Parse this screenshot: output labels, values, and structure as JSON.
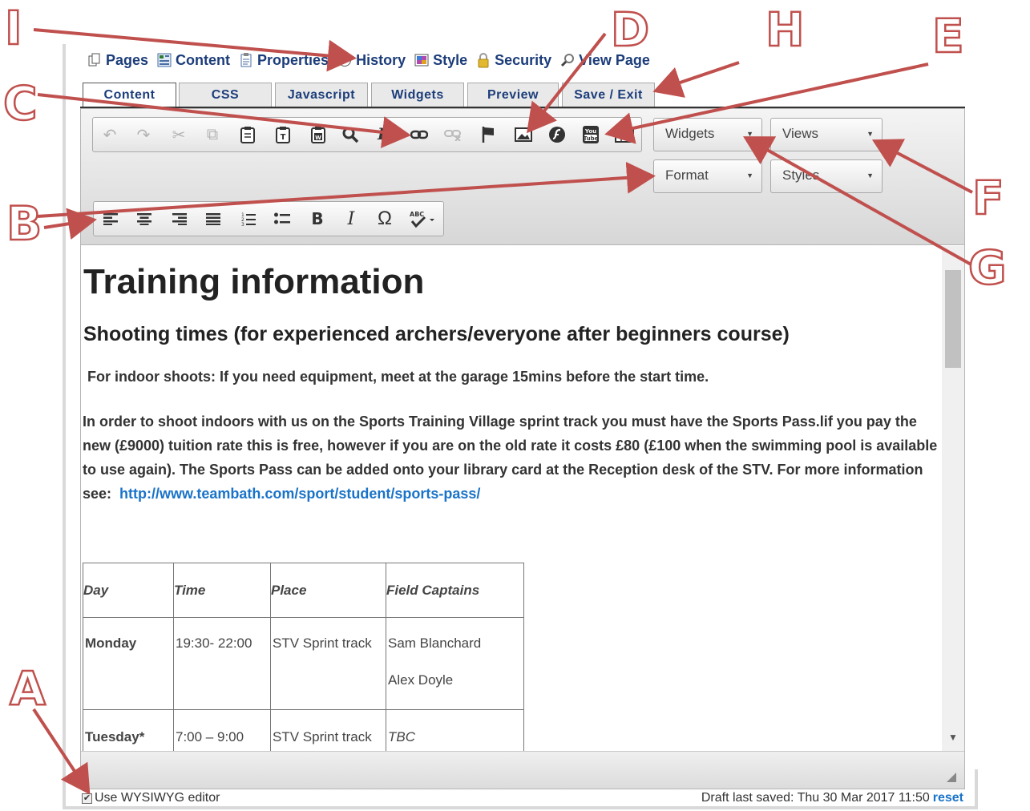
{
  "nav": [
    {
      "label": "Pages",
      "icon": "pages-icon"
    },
    {
      "label": "Content",
      "icon": "content-icon"
    },
    {
      "label": "Properties",
      "icon": "properties-icon"
    },
    {
      "label": "History",
      "icon": "history-icon"
    },
    {
      "label": "Style",
      "icon": "style-icon"
    },
    {
      "label": "Security",
      "icon": "lock-icon"
    },
    {
      "label": "View Page",
      "icon": "magnifier-icon"
    }
  ],
  "tabs": [
    {
      "label": "Content",
      "active": true
    },
    {
      "label": "CSS"
    },
    {
      "label": "Javascript"
    },
    {
      "label": "Widgets"
    },
    {
      "label": "Preview"
    },
    {
      "label": "Save / Exit"
    }
  ],
  "toolbar": {
    "row1": [
      "undo",
      "redo",
      "cut",
      "copy",
      "paste",
      "paste-as-text",
      "paste-from-word",
      "find",
      "remove-format",
      "link",
      "unlink",
      "anchor",
      "image",
      "flash",
      "youtube",
      "table"
    ],
    "row2": [
      "align-left",
      "align-center",
      "align-right",
      "justify",
      "numbered-list",
      "bulleted-list",
      "bold",
      "italic",
      "special-character",
      "spell-check"
    ],
    "combos": {
      "widgets": "Widgets",
      "views": "Views",
      "format": "Format",
      "styles": "Styles"
    }
  },
  "document": {
    "h1": "Training information",
    "h2": "Shooting times (for experienced archers/everyone after beginners course)",
    "p1": "For indoor shoots: If you need equipment, meet at the garage 15mins before the start time.",
    "p2": "In order to shoot indoors with us on the Sports Training Village sprint track you must have the Sports Pass.lif you pay the new (£9000) tuition rate this is free, however if you are on the old rate it costs £80 (£100 when the swimming pool is available to use again). The Sports Pass can be added onto your library card at the Reception desk of the STV. For more information see:",
    "link": "http://www.teambath.com/sport/student/sports-pass/",
    "table": {
      "headers": [
        "Day",
        "Time",
        "Place",
        "Field Captains"
      ],
      "rows": [
        {
          "day": "Monday",
          "time": "19:30- 22:00",
          "place": "STV Sprint track",
          "captains": [
            "Sam Blanchard",
            "Alex Doyle"
          ]
        },
        {
          "day": "Tuesday*",
          "time": "7:00 – 9:00",
          "place": "STV Sprint track",
          "captains": [
            "TBC"
          ]
        }
      ]
    }
  },
  "footer": {
    "wysiwyg_label": "Use WYSIWYG editor",
    "wysiwyg_checked": true,
    "draft_text": "Draft last saved: Thu 30 Mar 2017 11:50",
    "reset_label": "reset"
  },
  "annotations": {
    "I": "I",
    "D": "D",
    "H": "H",
    "E": "E",
    "C": "C",
    "B": "B",
    "F": "F",
    "G": "G",
    "A": "A",
    "color": "#c0504d"
  }
}
